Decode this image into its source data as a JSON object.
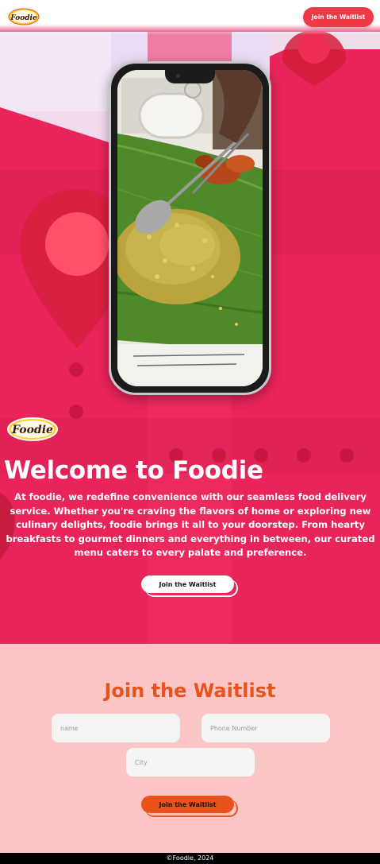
{
  "header": {
    "logo_text": "Foodie",
    "cta_label": "Join the Waitlist"
  },
  "hero": {
    "logo_text": "Foodie",
    "title": "Welcome to Foodie",
    "description": "At foodie, we redefine convenience with our seamless food delivery service. Whether you're craving the flavors of home or exploring new culinary delights, foodie brings it all to your doorstep. From hearty breakfasts to gourmet dinners and everything in between, our curated menu caters to every palate and preference.",
    "cta_label": "Join the Waitlist"
  },
  "waitlist": {
    "title": "Join the Waitlist",
    "name_placeholder": "name",
    "phone_placeholder": "Phone Number",
    "city_placeholder": "City",
    "submit_label": "Join the Waitlist"
  },
  "footer": {
    "copyright": "©Foodie, 2024"
  },
  "colors": {
    "brand_red": "#ef3a45",
    "hero_bg": "#e8245a",
    "waitlist_bg": "#fcc6c6",
    "accent_orange": "#e8531c",
    "footer_bg": "#000000"
  },
  "icons": [
    "location-pin-icon",
    "foodie-logo"
  ]
}
